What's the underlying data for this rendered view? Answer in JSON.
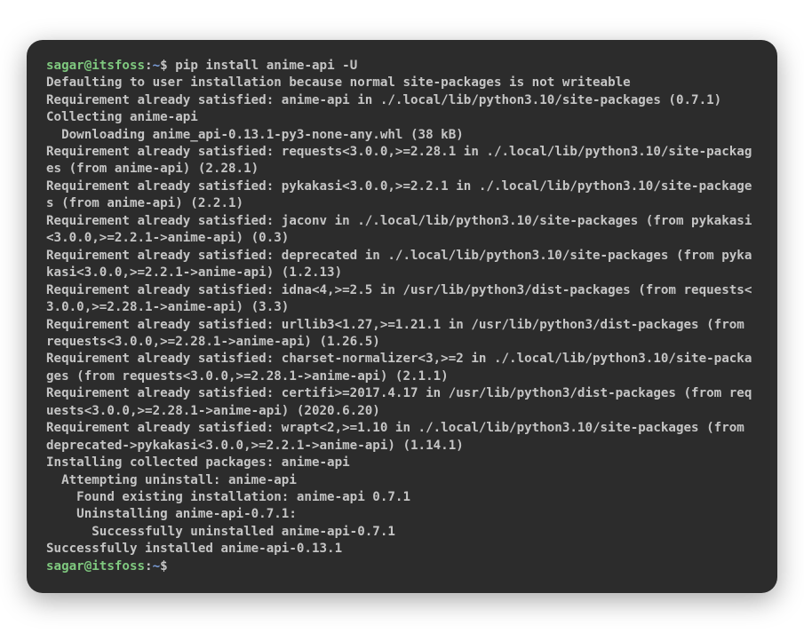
{
  "prompt1": {
    "user": "sagar@itsfoss",
    "colon": ":",
    "path": "~",
    "dollar": "$ "
  },
  "command": "pip install anime-api -U",
  "lines": [
    "Defaulting to user installation because normal site-packages is not writeable",
    "Requirement already satisfied: anime-api in ./.local/lib/python3.10/site-packages (0.7.1)",
    "Collecting anime-api",
    "  Downloading anime_api-0.13.1-py3-none-any.whl (38 kB)",
    "Requirement already satisfied: requests<3.0.0,>=2.28.1 in ./.local/lib/python3.10/site-packages (from anime-api) (2.28.1)",
    "Requirement already satisfied: pykakasi<3.0.0,>=2.2.1 in ./.local/lib/python3.10/site-packages (from anime-api) (2.2.1)",
    "Requirement already satisfied: jaconv in ./.local/lib/python3.10/site-packages (from pykakasi<3.0.0,>=2.2.1->anime-api) (0.3)",
    "Requirement already satisfied: deprecated in ./.local/lib/python3.10/site-packages (from pykakasi<3.0.0,>=2.2.1->anime-api) (1.2.13)",
    "Requirement already satisfied: idna<4,>=2.5 in /usr/lib/python3/dist-packages (from requests<3.0.0,>=2.28.1->anime-api) (3.3)",
    "Requirement already satisfied: urllib3<1.27,>=1.21.1 in /usr/lib/python3/dist-packages (from requests<3.0.0,>=2.28.1->anime-api) (1.26.5)",
    "Requirement already satisfied: charset-normalizer<3,>=2 in ./.local/lib/python3.10/site-packages (from requests<3.0.0,>=2.28.1->anime-api) (2.1.1)",
    "Requirement already satisfied: certifi>=2017.4.17 in /usr/lib/python3/dist-packages (from requests<3.0.0,>=2.28.1->anime-api) (2020.6.20)",
    "Requirement already satisfied: wrapt<2,>=1.10 in ./.local/lib/python3.10/site-packages (from deprecated->pykakasi<3.0.0,>=2.2.1->anime-api) (1.14.1)",
    "Installing collected packages: anime-api",
    "  Attempting uninstall: anime-api",
    "    Found existing installation: anime-api 0.7.1",
    "    Uninstalling anime-api-0.7.1:",
    "      Successfully uninstalled anime-api-0.7.1",
    "Successfully installed anime-api-0.13.1"
  ],
  "prompt2": {
    "user": "sagar@itsfoss",
    "colon": ":",
    "path": "~",
    "dollar": "$ "
  }
}
